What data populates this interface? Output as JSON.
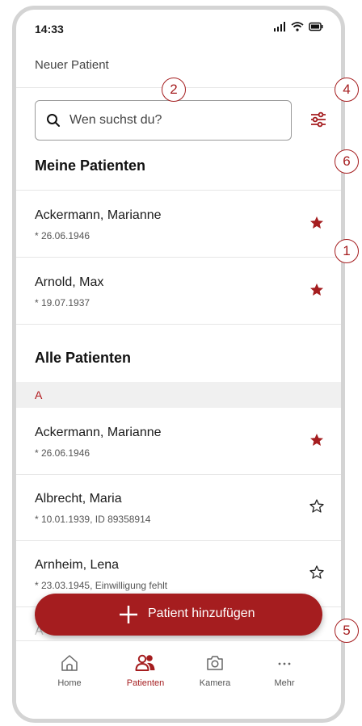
{
  "status_bar": {
    "time": "14:33"
  },
  "header": {
    "title": "Neuer Patient"
  },
  "search": {
    "placeholder": "Wen suchst du?"
  },
  "my_patients": {
    "title": "Meine Patienten",
    "items": [
      {
        "name": "Ackermann, Marianne",
        "details": "* 26.06.1946",
        "favorite": true
      },
      {
        "name": "Arnold, Max",
        "details": "* 19.07.1937",
        "favorite": true
      }
    ]
  },
  "all_patients": {
    "title": "Alle Patienten",
    "letter": "A",
    "items": [
      {
        "name": "Ackermann, Marianne",
        "details": "* 26.06.1946",
        "favorite": true
      },
      {
        "name": "Albrecht, Maria",
        "details": "* 10.01.1939, ID 89358914",
        "favorite": false
      },
      {
        "name": "Arnheim, Lena",
        "details": "* 23.03.1945, Einwilligung fehlt",
        "favorite": false
      },
      {
        "name": "A",
        "details": "",
        "favorite": false
      }
    ]
  },
  "fab": {
    "label": "Patient hinzufügen"
  },
  "bottom_nav": [
    {
      "label": "Home",
      "icon": "home-icon",
      "active": false
    },
    {
      "label": "Patienten",
      "icon": "patients-icon",
      "active": true
    },
    {
      "label": "Kamera",
      "icon": "camera-icon",
      "active": false
    },
    {
      "label": "Mehr",
      "icon": "more-icon",
      "active": false
    }
  ],
  "annotations": [
    "2",
    "4",
    "6",
    "1",
    "5"
  ],
  "colors": {
    "accent": "#a51d1f",
    "border": "#d4d4d4",
    "section_bg": "#f0f0f0"
  }
}
